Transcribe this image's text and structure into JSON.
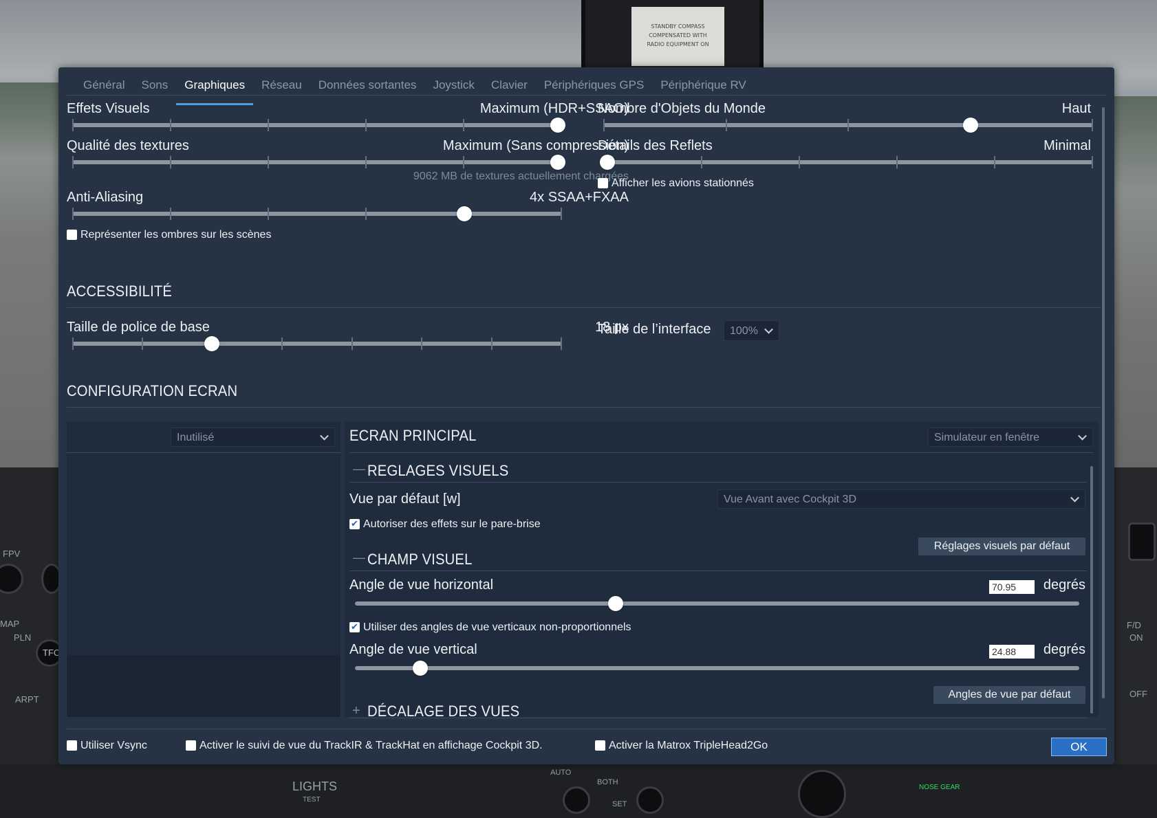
{
  "background": {
    "compass_card": "STANDBY COMPASS\nCOMPENSATED WITH\nRADIO EQUIPMENT ON",
    "panel_labels": [
      "FPV",
      "MAP",
      "PLN",
      "TFC",
      "ARPT",
      "LIGHTS",
      "TEST",
      "AUTO",
      "BOTH",
      "SET",
      "F/D",
      "ON",
      "OFF",
      "NOSE GEAR"
    ]
  },
  "tabs": [
    {
      "label": "Général"
    },
    {
      "label": "Sons"
    },
    {
      "label": "Graphiques"
    },
    {
      "label": "Réseau"
    },
    {
      "label": "Données sortantes"
    },
    {
      "label": "Joystick"
    },
    {
      "label": "Clavier"
    },
    {
      "label": "Périphériques GPS"
    },
    {
      "label": "Périphérique  RV"
    }
  ],
  "graphics": {
    "visual_effects": {
      "label": "Effets Visuels",
      "value": "Maximum (HDR+SSAO)",
      "level": 1.0
    },
    "texture_quality": {
      "label": "Qualité des textures",
      "value": "Maximum (Sans compression)",
      "level": 1.0,
      "note": "9062 MB de textures actuellement chargées"
    },
    "anti_aliasing": {
      "label": "Anti-Aliasing",
      "value": "4x SSAA+FXAA",
      "level": 0.8
    },
    "shadows_checkbox": {
      "label": "Représenter les ombres sur les scènes",
      "checked": false
    },
    "world_objects": {
      "label": "Nombre d'Objets du Monde",
      "value": "Haut",
      "level": 0.75
    },
    "reflection_detail": {
      "label": "Détails des Reflets",
      "value": "Minimal",
      "level": 0.0
    },
    "parked_planes_checkbox": {
      "label": "Afficher les avions stationnés",
      "checked": false
    }
  },
  "accessibility": {
    "title": "ACCESSIBILITÉ",
    "font_size": {
      "label": "Taille de police de base",
      "value": "18 px",
      "level": 0.285
    },
    "ui_size": {
      "label": "Taille de l’interface",
      "value": "100%"
    }
  },
  "screen_config": {
    "title": "CONFIGURATION ECRAN",
    "left_dropdown": "Inutilisé",
    "main_screen_title": "ECRAN PRINCIPAL",
    "window_mode": "Simulateur en fenêtre",
    "visual_settings": {
      "title": "REGLAGES VISUELS",
      "collapse_glyph": "—",
      "default_view_label": "Vue par défaut [w]",
      "default_view_value": "Vue Avant avec Cockpit 3D",
      "windshield_checkbox": {
        "label": "Autoriser des effets sur le pare-brise",
        "checked": true
      },
      "reset_button": "Réglages visuels par défaut"
    },
    "field_of_view": {
      "title": "CHAMP VISUEL",
      "collapse_glyph": "—",
      "horizontal": {
        "label": "Angle de vue horizontal",
        "value": "70.95",
        "unit": "degrés",
        "level": 0.36
      },
      "nonprop_checkbox": {
        "label": "Utiliser des angles de vue verticaux non-proportionnels",
        "checked": true
      },
      "vertical": {
        "label": "Angle de vue vertical",
        "value": "24.88",
        "unit": "degrés",
        "level": 0.09
      },
      "reset_button": "Angles de vue par défaut"
    },
    "view_offset": {
      "title": "DÉCALAGE DES VUES",
      "expand_glyph": "+"
    }
  },
  "footer": {
    "vsync": {
      "label": "Utiliser Vsync",
      "checked": false
    },
    "trackir": {
      "label": "Activer le suivi de vue du TrackIR & TrackHat en affichage Cockpit 3D.",
      "checked": false
    },
    "matrox": {
      "label": "Activer la Matrox TripleHead2Go",
      "checked": false
    },
    "ok": "OK"
  },
  "colors": {
    "accent": "#4a9fe0",
    "dialog_bg": "#253345",
    "ok_button": "#2970c4"
  }
}
